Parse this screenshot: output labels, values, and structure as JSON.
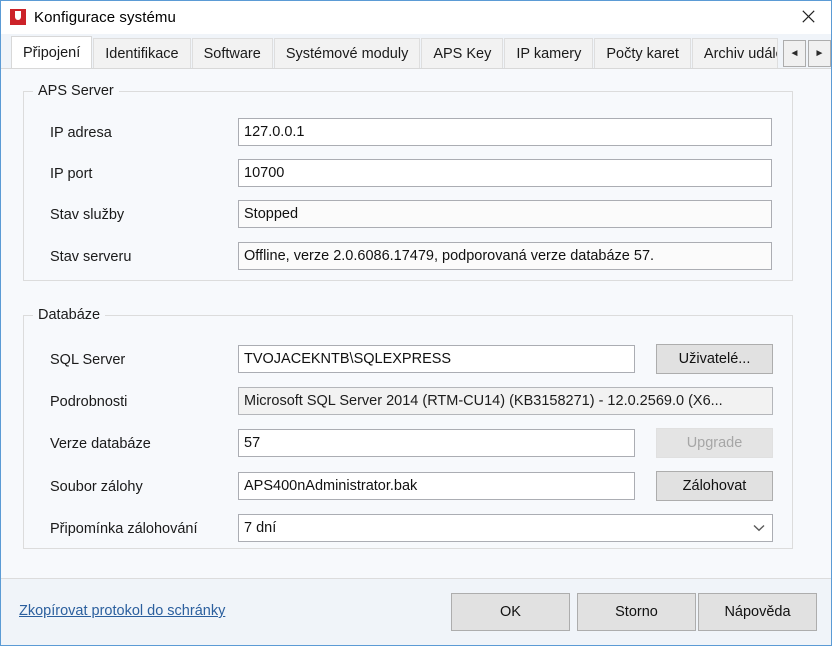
{
  "window": {
    "title": "Konfigurace systému",
    "icon": "app-icon",
    "close_label": "✕"
  },
  "tabs": {
    "items": [
      {
        "label": "Připojení",
        "selected": true
      },
      {
        "label": "Identifikace",
        "selected": false
      },
      {
        "label": "Software",
        "selected": false
      },
      {
        "label": "Systémové moduly",
        "selected": false
      },
      {
        "label": "APS Key",
        "selected": false
      },
      {
        "label": "IP kamery",
        "selected": false
      },
      {
        "label": "Počty karet",
        "selected": false
      },
      {
        "label": "Archiv událo",
        "selected": false
      }
    ],
    "scroll_prev": "◄",
    "scroll_next": "►"
  },
  "aps_server": {
    "legend": "APS Server",
    "ip_address_label": "IP adresa",
    "ip_address_value": "127.0.0.1",
    "ip_port_label": "IP port",
    "ip_port_value": "10700",
    "service_state_label": "Stav služby",
    "service_state_value": "Stopped",
    "server_state_label": "Stav serveru",
    "server_state_value": "Offline, verze 2.0.6086.17479, podporovaná verze databáze 57."
  },
  "database": {
    "legend": "Databáze",
    "sql_server_label": "SQL Server",
    "sql_server_value": "TVOJACEKNTB\\SQLEXPRESS",
    "users_button": "Uživatelé...",
    "details_label": "Podrobnosti",
    "details_value": "Microsoft SQL Server 2014 (RTM-CU14) (KB3158271) - 12.0.2569.0 (X6...",
    "db_version_label": "Verze databáze",
    "db_version_value": "57",
    "upgrade_button": "Upgrade",
    "backup_file_label": "Soubor zálohy",
    "backup_file_value": "APS400nAdministrator.bak",
    "backup_button": "Zálohovat",
    "reminder_label": "Připomínka zálohování",
    "reminder_value": "7 dní"
  },
  "footer": {
    "log_link": "Zkopírovat protokol do schránky",
    "ok": "OK",
    "cancel": "Storno",
    "help": "Nápověda"
  },
  "colors": {
    "window_border": "#5b9bd5",
    "dialog_bg": "#f0f4f9",
    "page_bg": "#f7f9fc",
    "link": "#2b5f9e",
    "icon_red": "#cc2229",
    "button_face": "#e1e1e1",
    "field_border": "#abadb3"
  }
}
